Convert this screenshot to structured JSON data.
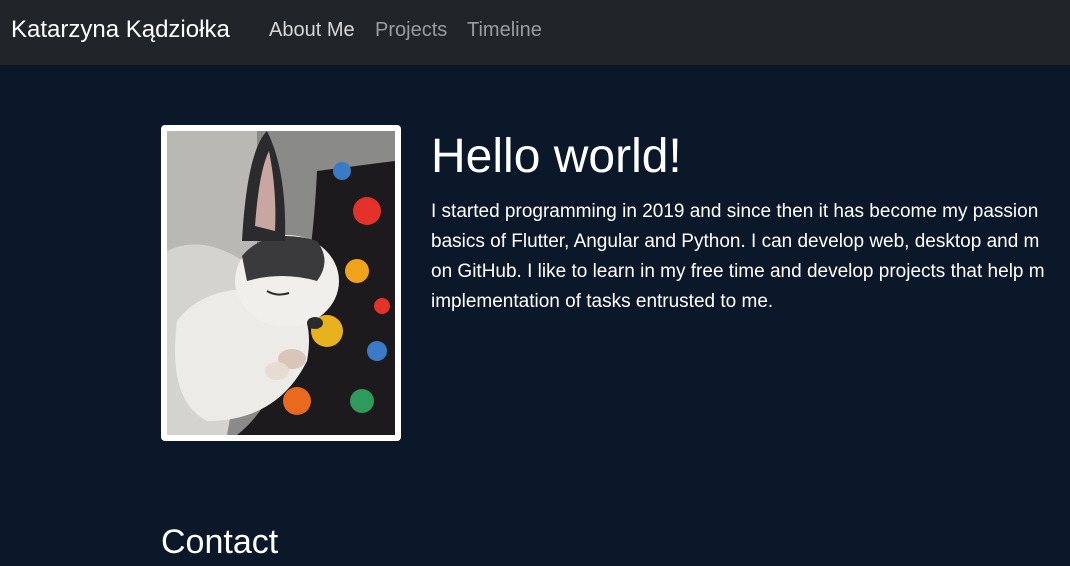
{
  "navbar": {
    "brand": "Katarzyna Kądziołka",
    "links": [
      {
        "label": "About Me"
      },
      {
        "label": "Projects"
      },
      {
        "label": "Timeline"
      }
    ]
  },
  "about": {
    "title": "Hello world!",
    "lines": [
      "I started programming in 2019 and since then it has become my passion",
      "basics of Flutter, Angular and Python. I can develop web, desktop and m",
      "on GitHub. I like to learn in my free time and develop projects that help m",
      "implementation of tasks entrusted to me."
    ]
  },
  "contact": {
    "title": "Contact"
  },
  "colors": {
    "page_background": "#0b1829",
    "navbar_background": "#212529",
    "active_link": "#d6d7d8",
    "inactive_link": "#9a9da0"
  }
}
